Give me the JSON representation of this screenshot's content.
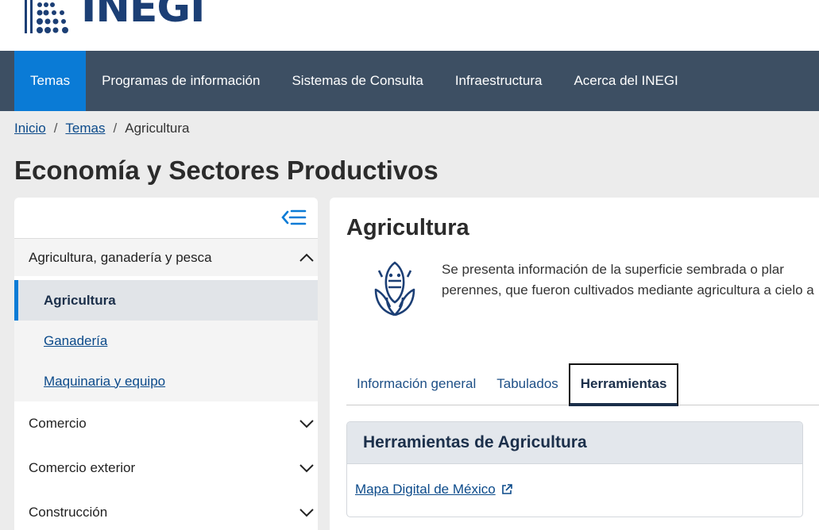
{
  "header": {
    "logo_text": "INEGI"
  },
  "nav": {
    "items": [
      {
        "label": "Temas"
      },
      {
        "label": "Programas de información"
      },
      {
        "label": "Sistemas de Consulta"
      },
      {
        "label": "Infraestructura"
      },
      {
        "label": "Acerca del INEGI"
      }
    ],
    "active_index": 0
  },
  "breadcrumb": {
    "home": "Inicio",
    "section": "Temas",
    "current": "Agricultura",
    "separator": "/"
  },
  "page_title": "Economía y Sectores Productivos",
  "sidebar": {
    "collapse_icon": "collapse-menu-icon",
    "open_group": "Agricultura, ganadería y pesca",
    "subitems": [
      "Agricultura",
      "Ganadería",
      "Maquinaria y equipo"
    ],
    "active_subitem": "Agricultura",
    "groups": [
      "Comercio",
      "Comercio exterior",
      "Construcción"
    ]
  },
  "content": {
    "title": "Agricultura",
    "icon": "corn-icon",
    "description_line1": "Se presenta información de la superficie sembrada o plar",
    "description_line2": "perennes, que fueron cultivados mediante agricultura a cielo a",
    "tabs": [
      "Información general",
      "Tabulados",
      "Herramientas"
    ],
    "active_tab": "Herramientas",
    "panel_title": "Herramientas de Agricultura",
    "panel_link": "Mapa Digital de México",
    "link_icon": "external-link-icon"
  },
  "colors": {
    "nav_bg": "#3d4f63",
    "accent": "#0a7bd6",
    "brand": "#1c3f75",
    "link": "#0b4a8a"
  }
}
